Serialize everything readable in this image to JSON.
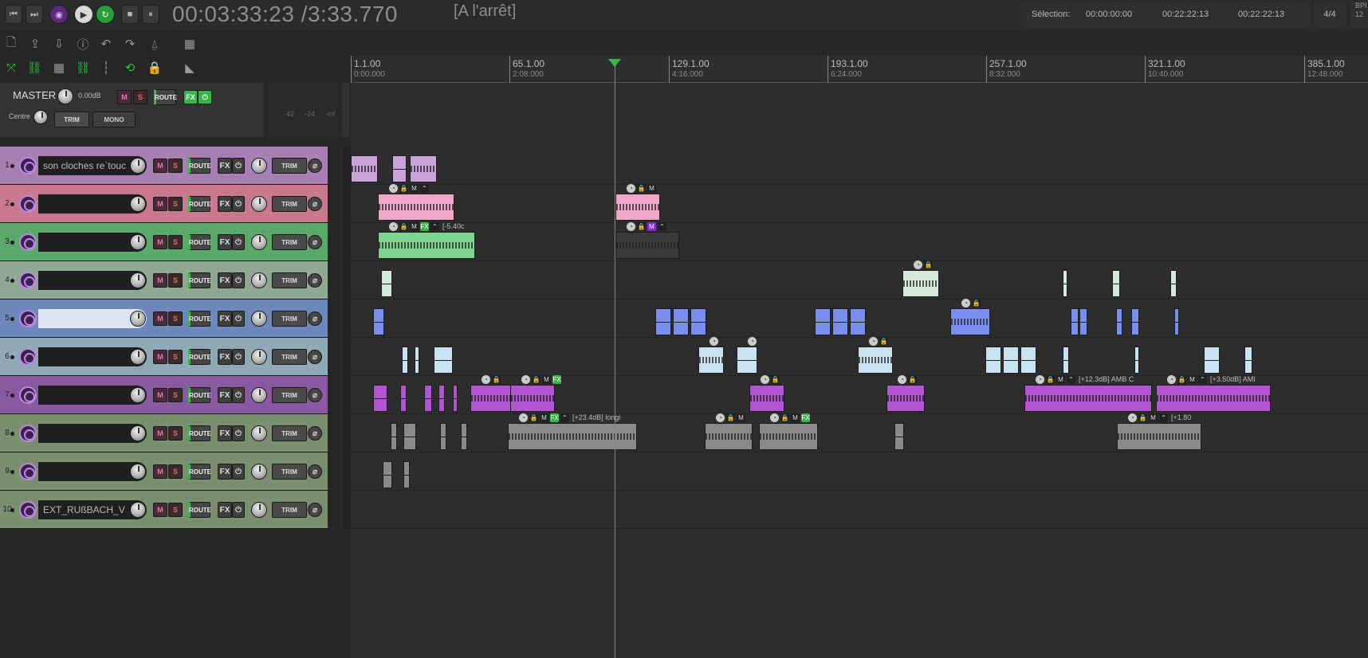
{
  "transport": {
    "time": "00:03:33:23 /3:33.770",
    "state": "[A l'arrêt]",
    "buttons": {
      "prev": "⏮",
      "next": "⏭",
      "record": "",
      "play": "▶",
      "repeat": "↻",
      "stop": "■",
      "pause": "⏸"
    }
  },
  "selection": {
    "label": "Sélection:",
    "start": "00:00:00:00",
    "end": "00:22:22:13",
    "length": "00:22:22:13"
  },
  "time_signature": "4/4",
  "bpm_label": "BPI 12",
  "master": {
    "name": "MASTER",
    "volume": "0.00dB",
    "pan": "Centre",
    "trim": "TRIM",
    "mono": "MONO",
    "mute": "M",
    "solo": "S",
    "route": "ROUTE",
    "fx": "FX",
    "meter_ticks": [
      "-42",
      "-24",
      "-inf"
    ]
  },
  "track_buttons": {
    "mute": "M",
    "solo": "S",
    "route": "ROUTE",
    "fx": "FX",
    "trim": "TRIM"
  },
  "tracks": [
    {
      "num": "1",
      "name": "son cloches re`touc",
      "color": "#a77fb3"
    },
    {
      "num": "2",
      "name": "",
      "color": "#c9788f"
    },
    {
      "num": "3",
      "name": "",
      "color": "#5aa86a"
    },
    {
      "num": "4",
      "name": "",
      "color": "#8fa894"
    },
    {
      "num": "5",
      "name": "",
      "color": "#6e88bb"
    },
    {
      "num": "6",
      "name": "",
      "color": "#8faab6"
    },
    {
      "num": "7",
      "name": "",
      "color": "#8a5aa0"
    },
    {
      "num": "8",
      "name": "",
      "color": "#7a8f6e"
    },
    {
      "num": "9",
      "name": "",
      "color": "#7a8f6e"
    },
    {
      "num": "10",
      "name": "EXT_RUßBACH_V",
      "color": "#7a8f6e"
    }
  ],
  "ruler": [
    {
      "m": "1.1.00",
      "s": "0:00.000"
    },
    {
      "m": "65.1.00",
      "s": "2:08.000"
    },
    {
      "m": "129.1.00",
      "s": "4:16.000"
    },
    {
      "m": "193.1.00",
      "s": "6:24.000"
    },
    {
      "m": "257.1.00",
      "s": "8:32.000"
    },
    {
      "m": "321.1.00",
      "s": "10:40.000"
    },
    {
      "m": "385.1.00",
      "s": "12:48.000"
    }
  ],
  "item_labels": {
    "t3": "[-5.40c",
    "t8a": "[+23.4dB] longi",
    "t7a": "[+12.3dB] AMB C",
    "t7b": "[+3.50dB] AMI",
    "t8b": "[+1.80"
  },
  "colors": {
    "cursor": "#3ab54a",
    "accent_green": "#29c23c",
    "record_purple": "#b98ae0"
  }
}
